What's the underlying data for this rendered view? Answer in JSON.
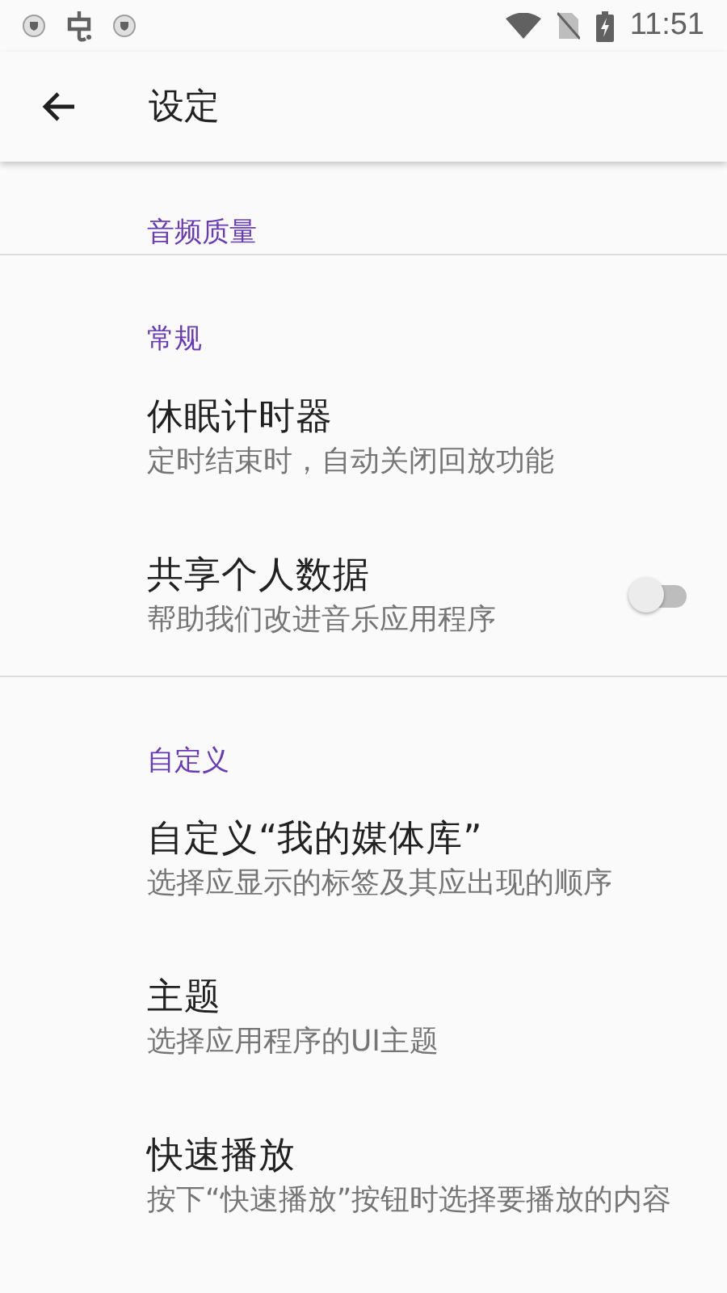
{
  "status_bar": {
    "time": "11:51"
  },
  "app_bar": {
    "title": "设定"
  },
  "sections": [
    {
      "header": "音频质量"
    },
    {
      "header": "常规",
      "items": [
        {
          "kind": "plain",
          "title": "休眠计时器",
          "subtitle": "定时结束时，自动关闭回放功能"
        },
        {
          "kind": "switch",
          "title": "共享个人数据",
          "subtitle": "帮助我们改进音乐应用程序",
          "on": false
        }
      ]
    },
    {
      "header": "自定义",
      "items": [
        {
          "kind": "plain",
          "title": "自定义“我的媒体库”",
          "subtitle": "选择应显示的标签及其应出现的顺序"
        },
        {
          "kind": "plain",
          "title": "主题",
          "subtitle": "选择应用程序的UI主题"
        },
        {
          "kind": "plain",
          "title": "快速播放",
          "subtitle": "按下“快速播放”按钮时选择要播放的内容"
        }
      ]
    }
  ]
}
